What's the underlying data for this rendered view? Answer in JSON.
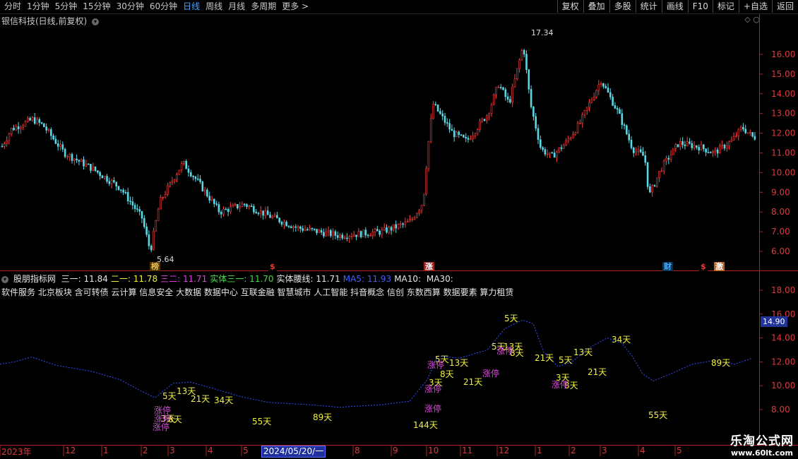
{
  "toolbar": {
    "periods": [
      "分时",
      "1分钟",
      "5分钟",
      "15分钟",
      "30分钟",
      "60分钟",
      "日线",
      "周线",
      "月线",
      "多周期",
      "更多 >"
    ],
    "active_period": "日线",
    "buttons": [
      "复权",
      "叠加",
      "多股",
      "统计",
      "画线",
      "F10",
      "标记",
      "+自选",
      "返回"
    ]
  },
  "stock": {
    "title": "银信科技(日线,前复权)"
  },
  "main_chart": {
    "y_ticks": [
      "16.00",
      "15.00",
      "14.00",
      "13.00",
      "12.00",
      "11.00",
      "10.00",
      "9.00",
      "8.00",
      "7.00",
      "6.00"
    ],
    "y_values": [
      16,
      15,
      14,
      13,
      12,
      11,
      10,
      9,
      8,
      7,
      6
    ],
    "high_label": "17.34",
    "low_label": "5.64",
    "markers": [
      {
        "text": "榜",
        "color": "#e0c060",
        "bg": "#553300",
        "idx": 0
      },
      {
        "text": "$",
        "color": "#ff3030",
        "bg": "#000000",
        "idx": 1
      },
      {
        "text": "涨",
        "color": "#ffffff",
        "bg": "#a02020",
        "idx": 2
      },
      {
        "text": "财",
        "color": "#40b0ff",
        "bg": "#103050",
        "idx": 3
      },
      {
        "text": "$",
        "color": "#ff3030",
        "bg": "#000000",
        "idx": 4
      },
      {
        "text": "激",
        "color": "#ffffff",
        "bg": "#c06020",
        "idx": 5
      }
    ]
  },
  "indicator": {
    "name": "股朋指标网",
    "items": [
      {
        "label": "三一:",
        "value": "11.84",
        "color": "#e6e6e6"
      },
      {
        "label": "二一:",
        "value": "11.78",
        "color": "#f0f040"
      },
      {
        "label": "三二:",
        "value": "11.71",
        "color": "#e040e0"
      },
      {
        "label": "实体三一:",
        "value": "11.70",
        "color": "#40e040"
      },
      {
        "label": "实体腰线:",
        "value": "11.71",
        "color": "#e6e6e6"
      },
      {
        "label": "MA5:",
        "value": "11.93",
        "color": "#4060ff"
      },
      {
        "label": "MA10:",
        "value": "",
        "color": "#e6e6e6"
      },
      {
        "label": "MA30:",
        "value": "",
        "color": "#e6e6e6"
      }
    ],
    "concepts": "软件服务 北京板块 含可转债 云计算 信息安全 大数据 数据中心 互联金融 智慧城市 人工智能 抖音概念 信创 东数西算 数据要素 算力租赁",
    "y_ticks": [
      "18.00",
      "16.00",
      "14.00",
      "12.00",
      "10.00",
      "8.00"
    ],
    "y_values": [
      18,
      16,
      14,
      12,
      10,
      8
    ],
    "current_price": "14.90",
    "annotations": [
      {
        "t": "5天",
        "c": "#f0f040"
      },
      {
        "t": "13天",
        "c": "#f0f040"
      },
      {
        "t": "21天",
        "c": "#f0f040"
      },
      {
        "t": "34天",
        "c": "#f0f040"
      },
      {
        "t": "3天",
        "c": "#f0f040"
      },
      {
        "t": "8天",
        "c": "#f0f040"
      },
      {
        "t": "55天",
        "c": "#f0f040"
      },
      {
        "t": "89天",
        "c": "#f0f040"
      },
      {
        "t": "144天",
        "c": "#f0f040"
      },
      {
        "t": "5天",
        "c": "#f0f040"
      },
      {
        "t": "13天",
        "c": "#f0f040"
      },
      {
        "t": "21天",
        "c": "#f0f040"
      },
      {
        "t": "3天",
        "c": "#f0f040"
      },
      {
        "t": "8天",
        "c": "#f0f040"
      },
      {
        "t": "5天",
        "c": "#f0f040"
      },
      {
        "t": "13天",
        "c": "#f0f040"
      },
      {
        "t": "5天",
        "c": "#f0f040"
      },
      {
        "t": "8天",
        "c": "#f0f040"
      },
      {
        "t": "21天",
        "c": "#f0f040"
      },
      {
        "t": "5天",
        "c": "#f0f040"
      },
      {
        "t": "13天",
        "c": "#f0f040"
      },
      {
        "t": "3天",
        "c": "#f0f040"
      },
      {
        "t": "8天",
        "c": "#f0f040"
      },
      {
        "t": "21天",
        "c": "#f0f040"
      },
      {
        "t": "34天",
        "c": "#f0f040"
      },
      {
        "t": "55天",
        "c": "#f0f040"
      },
      {
        "t": "89天",
        "c": "#f0f040"
      },
      {
        "t": "涨停",
        "c": "#d050d0"
      },
      {
        "t": "涨停",
        "c": "#d050d0"
      },
      {
        "t": "涨停",
        "c": "#d050d0"
      },
      {
        "t": "涨停",
        "c": "#d050d0"
      },
      {
        "t": "涨停",
        "c": "#d050d0"
      },
      {
        "t": "涨停",
        "c": "#d050d0"
      },
      {
        "t": "涨停",
        "c": "#d050d0"
      },
      {
        "t": "涨停",
        "c": "#d050d0"
      },
      {
        "t": "涨停",
        "c": "#d050d0"
      }
    ]
  },
  "xaxis": {
    "labels": [
      "2023年",
      "12",
      "1",
      "2",
      "3",
      "4",
      "5",
      "",
      "8",
      "9",
      "10",
      "11",
      "12",
      "1",
      "2",
      "3",
      "4",
      "5"
    ],
    "date_box": "2024/05/20/一"
  },
  "watermark": {
    "line1": "乐淘公式网",
    "line2": "www.60lt.com"
  }
}
